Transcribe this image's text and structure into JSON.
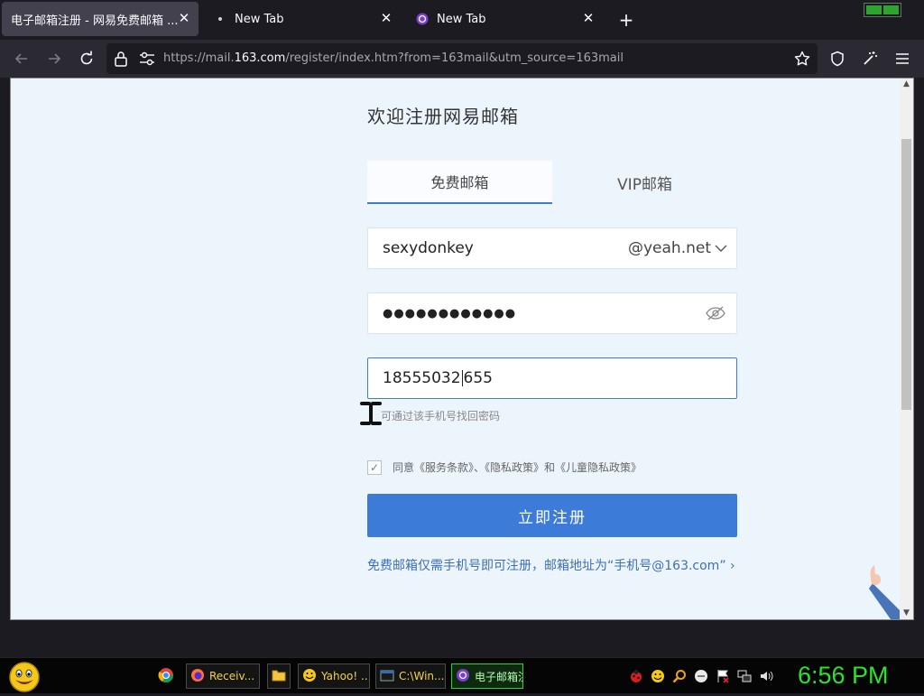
{
  "browser": {
    "tabs": [
      {
        "title": "电子邮箱注册 - 网易免费邮箱 ...",
        "active": true
      },
      {
        "title": "New Tab",
        "active": false
      },
      {
        "title": "New Tab",
        "active": false
      }
    ],
    "url": {
      "prefix": "https://mail.",
      "domain": "163.com",
      "path": "/register/index.htm?from=163mail&utm_source=163mail"
    }
  },
  "page": {
    "heading": "欢迎注册网易邮箱",
    "tabs": [
      {
        "label": "免费邮箱"
      },
      {
        "label": "VIP邮箱"
      }
    ],
    "email_field": {
      "value": "sexydonkey",
      "domain_suffix": "@yeah.net"
    },
    "password_field": {
      "value": "●●●●●●●●●●●●"
    },
    "phone_field": {
      "value_before_caret": "18555032",
      "value_after_caret": "655"
    },
    "phone_hint": "可通过该手机号找回密码",
    "agreement": {
      "text": "同意《服务条款》、《隐私政策》和《儿童隐私政策》",
      "checked": true
    },
    "register_button": "立即注册",
    "promo_link": "免费邮箱仅需手机号即可注册，邮箱地址为“手机号@163.com” ›"
  },
  "taskbar": {
    "items": [
      {
        "label": "Receiv..."
      },
      {
        "label": ""
      },
      {
        "label": "Yahoo! ..."
      },
      {
        "label": "C:\\Win..."
      },
      {
        "label": "电子邮箱注册 - ..."
      }
    ],
    "clock": "6:56 PM"
  },
  "colors": {
    "accent": "#3d7bd8",
    "page_bg": "#edf5fc",
    "clock": "#2fe02f"
  }
}
